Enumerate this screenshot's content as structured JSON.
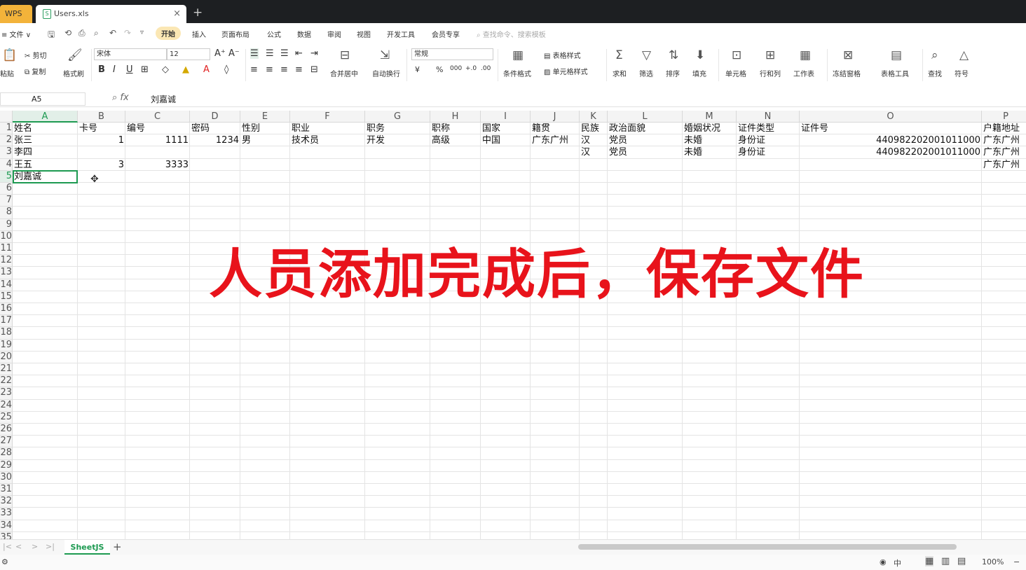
{
  "titlebar": {
    "wps_label": "WPS",
    "file_tab": "Users.xls",
    "close": "×",
    "new_tab": "+"
  },
  "menubar": {
    "items": [
      "≡ 文件 ∨",
      "开始",
      "插入",
      "页面布局",
      "公式",
      "数据",
      "审阅",
      "视图",
      "开发工具",
      "会员专享"
    ],
    "search_placeholder": "查找命令、搜索模板"
  },
  "ribbon": {
    "paste": "粘贴",
    "cut": "剪切",
    "copy": "复制",
    "format_painter": "格式刷",
    "font_name": "宋体",
    "font_size": "12",
    "merge": "合并居中",
    "wrap": "自动换行",
    "number_format": "常规",
    "cond_format": "条件格式",
    "table_style": "表格样式",
    "cell_style": "单元格样式",
    "sum": "求和",
    "filter": "筛选",
    "sort": "排序",
    "fill": "填充",
    "cells": "单元格",
    "rowcol": "行和列",
    "worksheet": "工作表",
    "freeze": "冻结窗格",
    "table_tools": "表格工具",
    "find": "查找",
    "symbol": "符号"
  },
  "formula": {
    "cell_ref": "A5",
    "fx": "fx",
    "value": "刘嘉诚"
  },
  "columns": [
    "A",
    "B",
    "C",
    "D",
    "E",
    "F",
    "G",
    "H",
    "I",
    "J",
    "K",
    "L",
    "M",
    "N",
    "O",
    "P"
  ],
  "rows": [
    [
      "姓名",
      "卡号",
      "编号",
      "密码",
      "性别",
      "职业",
      "职务",
      "职称",
      "国家",
      "籍贯",
      "民族",
      "政治面貌",
      "婚姻状况",
      "证件类型",
      "证件号",
      "户籍地址"
    ],
    [
      "张三",
      "1",
      "1111",
      "1234",
      "男",
      "技术员",
      "开发",
      "高级",
      "中国",
      "广东广州",
      "汉",
      "党员",
      "未婚",
      "身份证",
      "440982202001011000",
      "广东广州"
    ],
    [
      "李四",
      "",
      "",
      "",
      "",
      "",
      "",
      "",
      "",
      "",
      "汉",
      "党员",
      "未婚",
      "身份证",
      "440982202001011000",
      "广东广州"
    ],
    [
      "王五",
      "3",
      "3333",
      "",
      "",
      "",
      "",
      "",
      "",
      "",
      "",
      "",
      "",
      "",
      "",
      "广东广州"
    ],
    [
      "刘嘉诚",
      "",
      "",
      "",
      "",
      "",
      "",
      "",
      "",
      "",
      "",
      "",
      "",
      "",
      "",
      ""
    ]
  ],
  "row_numbers": [
    "1",
    "2",
    "3",
    "4",
    "5",
    "6",
    "7",
    "8",
    "9",
    "10",
    "11",
    "12",
    "13",
    "14",
    "15",
    "16",
    "17",
    "18",
    "19",
    "20",
    "21",
    "22",
    "23",
    "24",
    "25",
    "26",
    "27",
    "28",
    "29",
    "30",
    "31",
    "32",
    "33",
    "34",
    "35"
  ],
  "overlay": "人员添加完成后，保存文件",
  "sheet": {
    "name": "SheetJS",
    "add": "+"
  },
  "status": {
    "zoom": "100%",
    "ime": "中"
  },
  "colors": {
    "accent": "#1d9a51",
    "overlay": "#e8131b",
    "wps": "#f3b33a"
  }
}
